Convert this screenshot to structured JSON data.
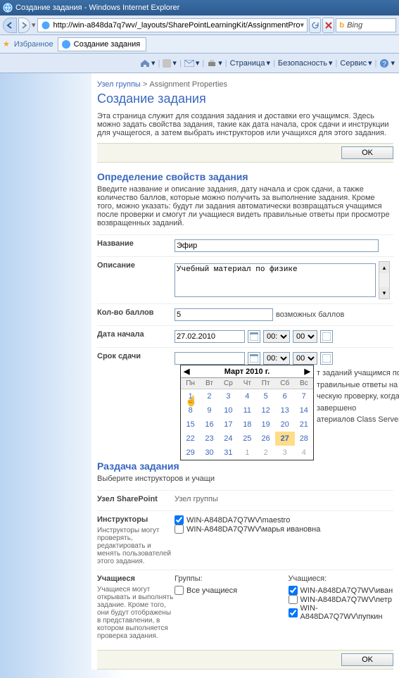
{
  "window_title": "Создание задания - Windows Internet Explorer",
  "url": "http://win-a848da7q7wv/_layouts/SharePointLearningKit/AssignmentPro",
  "search_engine": "Bing",
  "favorites": "Избранное",
  "tab_title": "Создание задания",
  "cmd": {
    "page": "Страница",
    "safety": "Безопасность",
    "service": "Сервис"
  },
  "breadcrumb": {
    "root": "Узел группы",
    "current": "Assignment Properties"
  },
  "page_title": "Создание задания",
  "intro": "Эта страница служит для создания задания и доставки его учащимся. Здесь можно задать свойства задания, такие как дата начала, срок сдачи и инструкции для учащегося, а затем выбрать инструкторов или учащихся для этого задания.",
  "ok": "OK",
  "sec1_title": "Определение свойств задания",
  "sec1_desc": "Введите название и описание задания, дату начала и срок сдачи, а также количество баллов, которые можно получить за выполнение задания. Кроме того, можно указать: будут ли задания автоматически возвращаться учащимся после проверки и смогут ли учащиеся видеть правильные ответы при просмотре возвращенных заданий.",
  "labels": {
    "title": "Название",
    "desc": "Описание",
    "points": "Кол-во баллов",
    "points_sfx": "возможных баллов",
    "start": "Дата начала",
    "due": "Срок сдачи"
  },
  "values": {
    "title": "Эфир",
    "desc": "Учебный материал по физике",
    "points": "5",
    "start": "27.02.2010",
    "hour": "00:",
    "min": "00"
  },
  "behind_cal": {
    "l1": "т заданий учащимся после сдачи.",
    "l2": "травильные ответы на вопросы,",
    "l3": "ческую проверку, когда задание завершено",
    "l4": "атериалов Class Server)"
  },
  "calendar": {
    "title": "Март 2010 г.",
    "dow": [
      "Пн",
      "Вт",
      "Ср",
      "Чт",
      "Пт",
      "Сб",
      "Вс"
    ],
    "rows": [
      [
        {
          "d": "1"
        },
        {
          "d": "2"
        },
        {
          "d": "3"
        },
        {
          "d": "4"
        },
        {
          "d": "5"
        },
        {
          "d": "6"
        },
        {
          "d": "7"
        }
      ],
      [
        {
          "d": "8"
        },
        {
          "d": "9"
        },
        {
          "d": "10"
        },
        {
          "d": "11"
        },
        {
          "d": "12"
        },
        {
          "d": "13"
        },
        {
          "d": "14"
        }
      ],
      [
        {
          "d": "15"
        },
        {
          "d": "16"
        },
        {
          "d": "17"
        },
        {
          "d": "18"
        },
        {
          "d": "19"
        },
        {
          "d": "20"
        },
        {
          "d": "21"
        }
      ],
      [
        {
          "d": "22"
        },
        {
          "d": "23"
        },
        {
          "d": "24"
        },
        {
          "d": "25"
        },
        {
          "d": "26"
        },
        {
          "d": "27",
          "today": true
        },
        {
          "d": "28"
        }
      ],
      [
        {
          "d": "29"
        },
        {
          "d": "30"
        },
        {
          "d": "31"
        },
        {
          "d": "1",
          "dim": true
        },
        {
          "d": "2",
          "dim": true
        },
        {
          "d": "3",
          "dim": true
        },
        {
          "d": "4",
          "dim": true
        }
      ]
    ]
  },
  "sec2_title": "Раздача задания",
  "sec2_desc": "Выберите инструкторов и учащи",
  "sp_node": "Узел SharePoint",
  "sp_node_val": "Узел группы",
  "instructors_label": "Инструкторы",
  "instructors_desc": "Инструкторы могут проверять, редактировать и менять пользователей этого задания.",
  "instructors": [
    "WIN-A848DA7Q7WV\\maestro",
    "WIN-A848DA7Q7WV\\марья ивановна"
  ],
  "students_label": "Учащиеся",
  "students_desc": "Учащиеся могут открывать и выполнять задание. Кроме того, они будут отображены в представлении, в котором выполняется проверка задания.",
  "groups_label": "Группы:",
  "all_students": "Все учащиеся",
  "stud_col_label": "Учащиеся:",
  "students": [
    "WIN-A848DA7Q7WV\\иван",
    "WIN-A848DA7Q7WV\\петр",
    "WIN-A848DA7Q7WV\\пупкин"
  ]
}
